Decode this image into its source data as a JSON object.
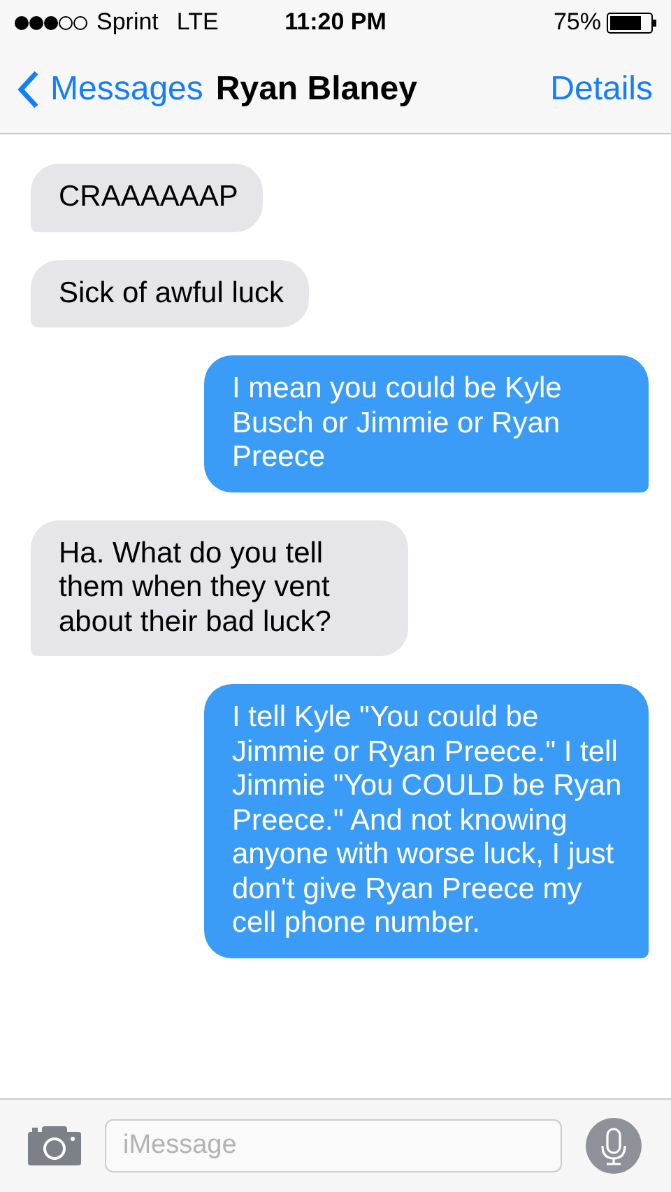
{
  "status_bar": {
    "carrier": "Sprint",
    "network": "LTE",
    "time": "11:20 PM",
    "battery": "75%"
  },
  "nav": {
    "back": "Messages",
    "title": "Ryan Blaney",
    "action": "Details"
  },
  "messages": [
    {
      "kind": "received",
      "text": "CRAAAAAAP"
    },
    {
      "kind": "received",
      "text": "Sick of awful luck"
    },
    {
      "kind": "sent",
      "text": "I mean you could be Kyle Busch or Jimmie or Ryan Preece"
    },
    {
      "kind": "received",
      "text": "Ha. What do you tell them when they vent about their bad luck?"
    },
    {
      "kind": "sent",
      "text": "I tell Kyle \"You could be Jimmie or Ryan Preece.\" I tell Jimmie \"You COULD be Ryan Preece.\" And not knowing anyone with worse luck, I just don't give Ryan Preece my cell phone number."
    }
  ],
  "composer": {
    "placeholder": "iMessage"
  }
}
